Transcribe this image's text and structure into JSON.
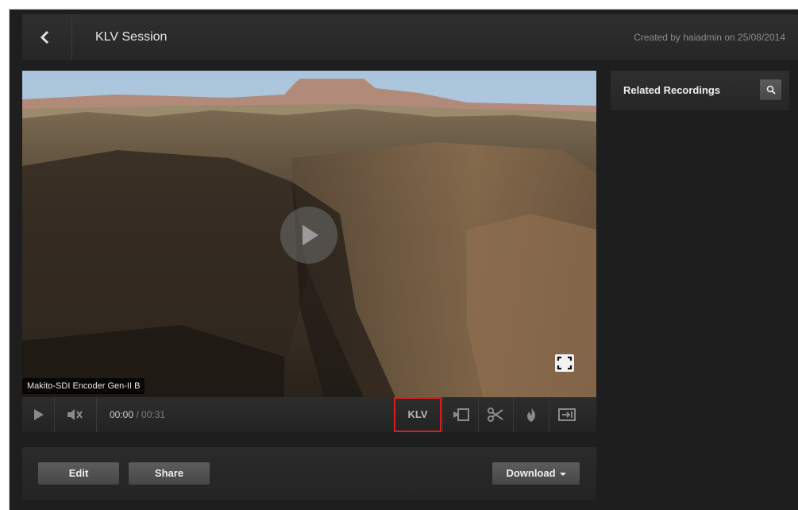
{
  "header": {
    "title": "KLV Session",
    "created_by": "Created by haiadmin on 25/08/2014"
  },
  "player": {
    "source_label": "Makito-SDI Encoder Gen-II B",
    "current_time": "00:00",
    "total_time": "/ 00:31",
    "klv_label": "KLV",
    "progress_fraction": 0
  },
  "actions": {
    "edit_label": "Edit",
    "share_label": "Share",
    "download_label": "Download"
  },
  "sidebar": {
    "related_title": "Related Recordings"
  },
  "icons": [
    "back-icon",
    "play-icon",
    "mute-icon",
    "marker-icon",
    "scissors-icon",
    "flame-icon",
    "export-icon",
    "fullscreen-icon",
    "search-icon"
  ],
  "colors": {
    "highlight": "#d81f1f",
    "panel": "#1e1e1e"
  }
}
